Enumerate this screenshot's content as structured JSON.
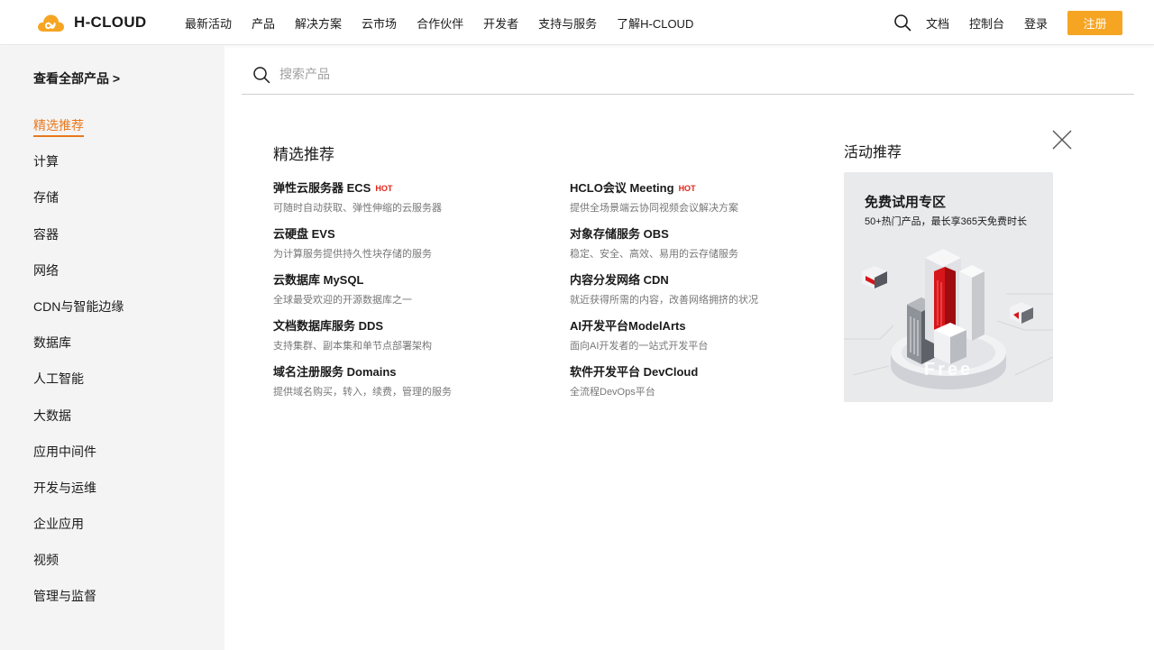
{
  "brand": {
    "name": "H-CLOUD",
    "accent": "#f6a523",
    "active_color": "#e8791e",
    "hot_color": "#e0251b"
  },
  "nav": {
    "items": [
      "最新活动",
      "产品",
      "解决方案",
      "云市场",
      "合作伙伴",
      "开发者",
      "支持与服务",
      "了解H-CLOUD"
    ]
  },
  "tools": {
    "docs": "文档",
    "console": "控制台",
    "login": "登录",
    "register": "注册"
  },
  "sidebar": {
    "all_products": "查看全部产品 >",
    "items": [
      {
        "label": "精选推荐",
        "active": true
      },
      {
        "label": "计算"
      },
      {
        "label": "存储"
      },
      {
        "label": "容器"
      },
      {
        "label": "网络"
      },
      {
        "label": "CDN与智能边缘"
      },
      {
        "label": "数据库"
      },
      {
        "label": "人工智能"
      },
      {
        "label": "大数据"
      },
      {
        "label": "应用中间件"
      },
      {
        "label": "开发与运维"
      },
      {
        "label": "企业应用"
      },
      {
        "label": "视频"
      },
      {
        "label": "管理与监督"
      }
    ]
  },
  "search": {
    "placeholder": "搜索产品"
  },
  "featured": {
    "title": "精选推荐",
    "hot_label": "HOT",
    "left": [
      {
        "name": "弹性云服务器 ECS",
        "hot": true,
        "desc": "可随时自动获取、弹性伸缩的云服务器"
      },
      {
        "name": "云硬盘 EVS",
        "desc": "为计算服务提供持久性块存储的服务"
      },
      {
        "name": "云数据库 MySQL",
        "desc": "全球最受欢迎的开源数据库之一"
      },
      {
        "name": "文档数据库服务 DDS",
        "desc": "支持集群、副本集和单节点部署架构"
      },
      {
        "name": "域名注册服务 Domains",
        "desc": "提供域名购买，转入，续费，管理的服务"
      }
    ],
    "right": [
      {
        "name": "HCLO会议 Meeting",
        "hot": true,
        "desc": "提供全场景端云协同视频会议解决方案"
      },
      {
        "name": "对象存储服务 OBS",
        "desc": "稳定、安全、高效、易用的云存储服务"
      },
      {
        "name": "内容分发网络 CDN",
        "desc": "就近获得所需的内容，改善网络拥挤的状况"
      },
      {
        "name": "AI开发平台ModelArts",
        "desc": "面向AI开发者的一站式开发平台"
      },
      {
        "name": "软件开发平台 DevCloud",
        "desc": "全流程DevOps平台"
      }
    ]
  },
  "activity": {
    "title": "活动推荐",
    "card_title": "免费试用专区",
    "card_sub": "50+热门产品，最长享365天免费时长",
    "art_text": "Free"
  }
}
